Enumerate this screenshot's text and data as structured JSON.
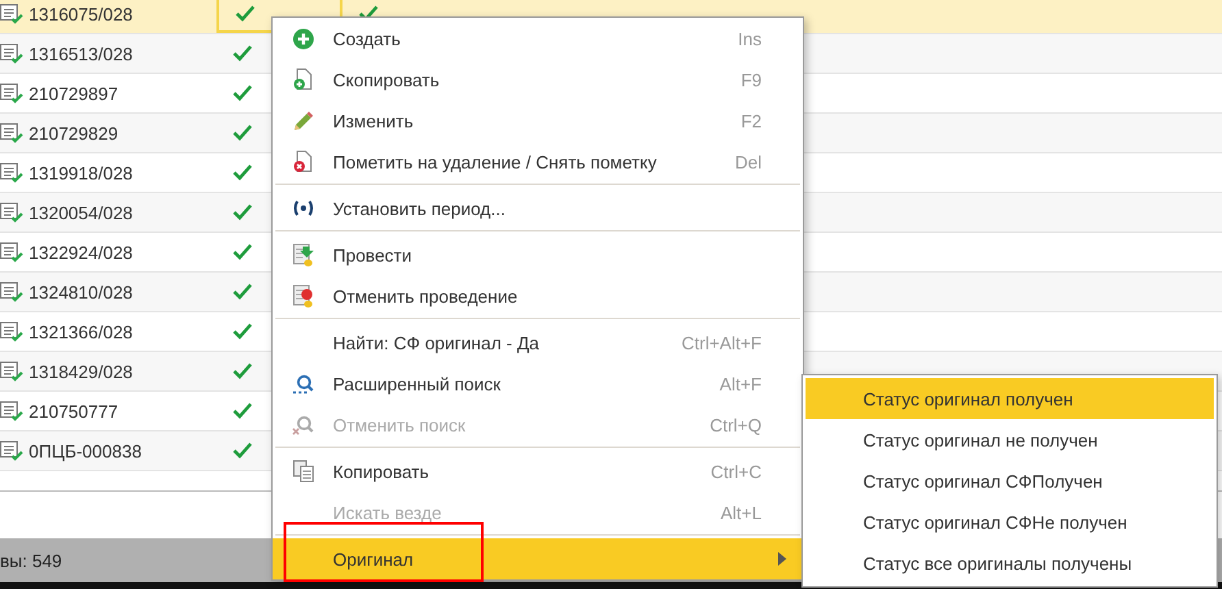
{
  "table": {
    "rows": [
      {
        "number": "1316075/028",
        "check_1": true,
        "check_2": true,
        "selected": true
      },
      {
        "number": "1316513/028",
        "check_1": true,
        "selected": false
      },
      {
        "number": "210729897",
        "check_1": true,
        "selected": false
      },
      {
        "number": "210729829",
        "check_1": true,
        "selected": false
      },
      {
        "number": "1319918/028",
        "check_1": true,
        "selected": false
      },
      {
        "number": "1320054/028",
        "check_1": true,
        "selected": false
      },
      {
        "number": "1322924/028",
        "check_1": true,
        "selected": false
      },
      {
        "number": "1324810/028",
        "check_1": true,
        "selected": false
      },
      {
        "number": "1321366/028",
        "check_1": true,
        "selected": false
      },
      {
        "number": "1318429/028",
        "check_1": true,
        "selected": false
      },
      {
        "number": "210750777",
        "check_1": true,
        "selected": false
      },
      {
        "number": "0ПЦБ-000838",
        "check_1": true,
        "selected": false
      }
    ]
  },
  "status_bar": {
    "text": "вы: 549"
  },
  "context_menu": {
    "groups": [
      [
        {
          "label": "Создать",
          "shortcut": "Ins",
          "kind": "plus",
          "disabled": false,
          "selected": false
        },
        {
          "label": "Скопировать",
          "shortcut": "F9",
          "kind": "copy",
          "disabled": false,
          "selected": false
        },
        {
          "label": "Изменить",
          "shortcut": "F2",
          "kind": "pencil",
          "disabled": false,
          "selected": false
        },
        {
          "label": "Пометить на удаление / Снять пометку",
          "shortcut": "Del",
          "kind": "delete",
          "disabled": false,
          "selected": false
        }
      ],
      [
        {
          "label": "Установить период...",
          "kind": "period",
          "disabled": false,
          "selected": false
        }
      ],
      [
        {
          "label": "Провести",
          "kind": "post",
          "disabled": false,
          "selected": false
        },
        {
          "label": "Отменить проведение",
          "kind": "unpost",
          "disabled": false,
          "selected": false
        }
      ],
      [
        {
          "label": "Найти: СФ оригинал - Да",
          "shortcut": "Ctrl+Alt+F",
          "disabled": false,
          "selected": false
        },
        {
          "label": "Расширенный поиск",
          "shortcut": "Alt+F",
          "kind": "search",
          "disabled": false,
          "selected": false
        },
        {
          "label": "Отменить поиск",
          "shortcut": "Ctrl+Q",
          "kind": "cancel-search",
          "disabled": true,
          "selected": false
        }
      ],
      [
        {
          "label": "Копировать",
          "shortcut": "Ctrl+C",
          "kind": "clipboard",
          "disabled": false,
          "selected": false
        },
        {
          "label": "Искать везде",
          "shortcut": "Alt+L",
          "disabled": true,
          "selected": false
        }
      ],
      [
        {
          "label": "Оригинал",
          "submenu": true,
          "marked": true,
          "disabled": false,
          "selected": true
        }
      ]
    ]
  },
  "submenu": {
    "items": [
      {
        "label": "Статус оригинал получен",
        "selected": true
      },
      {
        "label": "Статус оригинал не получен",
        "selected": false
      },
      {
        "label": "Статус оригинал СФПолучен",
        "selected": false
      },
      {
        "label": "Статус оригинал СФНе получен",
        "selected": false
      },
      {
        "label": "Статус все оригиналы получены",
        "selected": false
      }
    ]
  }
}
